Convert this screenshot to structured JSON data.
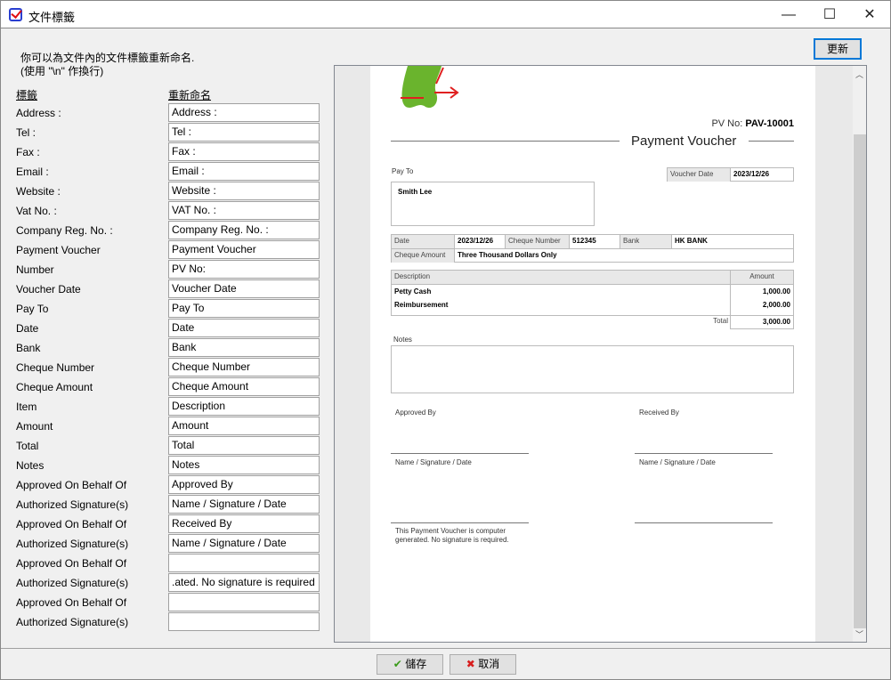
{
  "window": {
    "title": "文件標籤",
    "minimize": "—",
    "maximize": "☐",
    "close": "✕",
    "icon": "checklist-icon"
  },
  "hint": {
    "line1": "你可以為文件內的文件標籤重新命名.",
    "line2": "(使用 \"\\n\" 作換行)"
  },
  "columns": {
    "label": "標籤",
    "rename": "重新命名"
  },
  "rows": [
    {
      "label": "Address :",
      "value": "Address :"
    },
    {
      "label": "Tel :",
      "value": "Tel :"
    },
    {
      "label": "Fax :",
      "value": "Fax :"
    },
    {
      "label": "Email :",
      "value": "Email :"
    },
    {
      "label": "Website :",
      "value": "Website :"
    },
    {
      "label": "Vat No. :",
      "value": "VAT No. :"
    },
    {
      "label": "Company Reg. No. :",
      "value": "Company Reg. No. :"
    },
    {
      "label": "Payment Voucher",
      "value": "Payment Voucher"
    },
    {
      "label": "Number",
      "value": "PV No:"
    },
    {
      "label": "Voucher Date",
      "value": "Voucher Date"
    },
    {
      "label": "Pay To",
      "value": "Pay To"
    },
    {
      "label": "Date",
      "value": "Date"
    },
    {
      "label": "Bank",
      "value": "Bank"
    },
    {
      "label": "Cheque Number",
      "value": "Cheque Number"
    },
    {
      "label": "Cheque Amount",
      "value": "Cheque Amount"
    },
    {
      "label": "Item",
      "value": "Description"
    },
    {
      "label": "Amount",
      "value": "Amount"
    },
    {
      "label": "Total",
      "value": "Total"
    },
    {
      "label": "Notes",
      "value": "Notes"
    },
    {
      "label": "Approved On Behalf Of",
      "value": "Approved By"
    },
    {
      "label": "Authorized Signature(s)",
      "value": "Name / Signature / Date"
    },
    {
      "label": "Approved On Behalf Of",
      "value": "Received By"
    },
    {
      "label": "Authorized Signature(s)",
      "value": "Name / Signature / Date"
    },
    {
      "label": "Approved On Behalf Of",
      "value": ""
    },
    {
      "label": "Authorized Signature(s)",
      "value": "ated. No signature is required."
    },
    {
      "label": "Approved On Behalf Of",
      "value": ""
    },
    {
      "label": "Authorized Signature(s)",
      "value": ""
    }
  ],
  "refresh_label": "更新",
  "doc": {
    "pv_label": "PV No:",
    "pv_no": "PAV-10001",
    "title": "Payment Voucher",
    "pay_to_label": "Pay To",
    "pay_to": "Smith Lee",
    "voucher_date_label": "Voucher Date",
    "voucher_date": "2023/12/26",
    "date_label": "Date",
    "date": "2023/12/26",
    "cheque_no_label": "Cheque Number",
    "cheque_no": "512345",
    "bank_label": "Bank",
    "bank": "HK BANK",
    "cheque_amount_label": "Cheque Amount",
    "cheque_amount": "Three Thousand Dollars Only",
    "desc_label": "Description",
    "amount_label": "Amount",
    "items": [
      {
        "desc": "Petty Cash",
        "amount": "1,000.00"
      },
      {
        "desc": "Reimbursement",
        "amount": "2,000.00"
      }
    ],
    "total_label": "Total",
    "total": "3,000.00",
    "notes_label": "Notes",
    "approved_by": "Approved By",
    "received_by": "Received By",
    "sig_label": "Name / Signature / Date",
    "footer1": "This Payment Voucher is computer",
    "footer2": "generated. No signature is required."
  },
  "buttons": {
    "save": "儲存",
    "cancel": "取消"
  },
  "colors": {
    "accent": "#0078d7",
    "save_icon": "#3a9a1a",
    "cancel_icon": "#d81e1e"
  }
}
